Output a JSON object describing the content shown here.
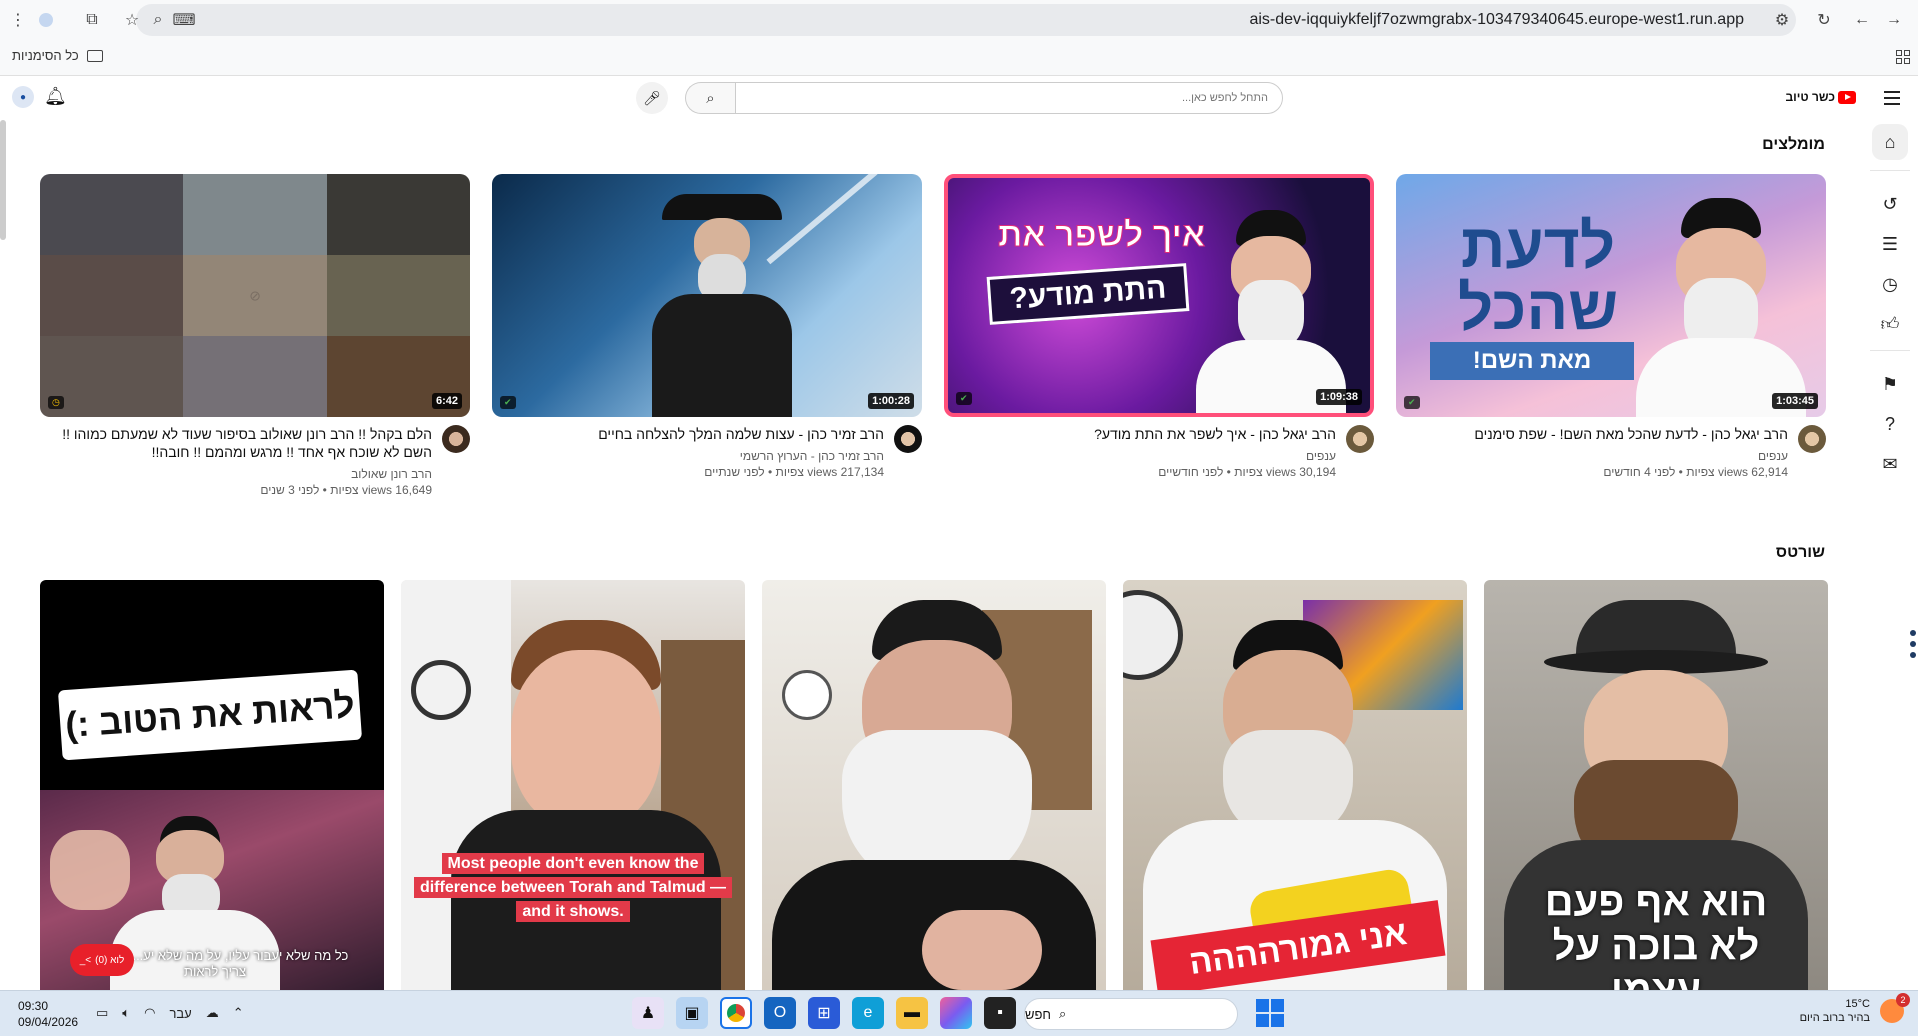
{
  "browser": {
    "url": "ais-dev-iqquiykfeljf7ozwmgrabx-103479340645.europe-west1.run.app",
    "bookmarks_label": "כל הסימניות"
  },
  "header": {
    "logo_text": "כשר טיוב",
    "search_placeholder": "התחל לחפש כאן..."
  },
  "sections": {
    "recommended": "מומלצים",
    "shorts": "שורטס"
  },
  "videos": [
    {
      "title": "הרב יגאל כהן - לדעת שהכל מאת השם! - שפת סימנים",
      "channel": "ענפים",
      "stats": "62,914 views צפיות • לפני 4 חודשים",
      "duration": "1:03:45",
      "thumb_text_1": "לדעת",
      "thumb_text_2": "שהכל",
      "thumb_text_3": "מאת השם!"
    },
    {
      "title": "הרב יגאל כהן - איך לשפר את התת מודע?",
      "channel": "ענפים",
      "stats": "30,194 views צפיות • לפני חודשיים",
      "duration": "1:09:38",
      "thumb_text_1": "איך לשפר את",
      "thumb_text_2": "התת מודע?"
    },
    {
      "title": "הרב זמיר כהן - עצות שלמה המלך להצלחה בחיים",
      "channel": "הרב זמיר כהן - הערוץ הרשמי",
      "stats": "217,134 views צפיות • לפני שנתיים",
      "duration": "1:00:28"
    },
    {
      "title": "הלם בקהל !! הרב רונן שאולוב בסיפור שעוד לא שמעתם כמוהו !! השם לא שוכח אף אחד !! מרגש ומהמם !! חובה!!",
      "channel": "הרב רונן שאולוב",
      "stats": "16,649 views צפיות • לפני 3 שנים",
      "duration": "6:42"
    }
  ],
  "shorts": [
    {
      "overlay": "הוא אף פעם לא בוכה על עצמו"
    },
    {
      "overlay": "אני גמורהההה"
    },
    {
      "overlay": ""
    },
    {
      "overlay": "Most people don't even know the difference between Torah and Talmud — and it shows."
    },
    {
      "overlay": "לראות את הטוב :)",
      "caption": "כל מה שלא יעבור עליו, על מה שלא יע... אדם הוא צריך לראות",
      "live_badge": "לוא (0)"
    }
  ],
  "taskbar": {
    "time": "09:30",
    "date": "09/04/2026",
    "lang": "עבר",
    "search_label": "חפש",
    "weather_temp": "15°C",
    "weather_desc": "בהיר ברוב היום",
    "notif_count": "2"
  }
}
